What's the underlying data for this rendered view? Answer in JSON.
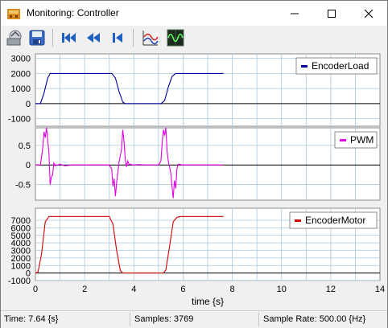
{
  "window": {
    "title": "Monitoring: Controller"
  },
  "toolbar": {
    "buttons": [
      {
        "name": "open-button",
        "icon": "open-folder-icon"
      },
      {
        "name": "save-button",
        "icon": "save-icon"
      },
      {
        "name": "go-to-start-button",
        "icon": "skip-to-start-icon"
      },
      {
        "name": "rewind-button",
        "icon": "rewind-icon"
      },
      {
        "name": "step-back-button",
        "icon": "step-back-icon"
      },
      {
        "name": "plot-settings-button",
        "icon": "plot-settings-icon"
      },
      {
        "name": "oscilloscope-button",
        "icon": "oscilloscope-icon"
      }
    ]
  },
  "colors": {
    "encoder_load": "#0000a0",
    "pwm": "#e000e0",
    "encoder_motor": "#d00000",
    "grid": "#aac8de",
    "zero_line": "#000000"
  },
  "chart_data": [
    {
      "type": "line",
      "legend_position": "top-right",
      "grid": true,
      "xlim": [
        0,
        14
      ],
      "ylim": [
        -1500,
        3300
      ],
      "y_ticks": [
        "3000",
        "2000",
        "1000",
        "0",
        "-1000"
      ],
      "series": [
        {
          "name": "EncoderLoad",
          "x": [
            0,
            0.2,
            0.35,
            0.5,
            0.6,
            3.1,
            3.25,
            3.4,
            3.55,
            3.65,
            5.1,
            5.25,
            5.4,
            5.55,
            5.7,
            7.64
          ],
          "y": [
            0,
            0,
            700,
            1700,
            2000,
            2000,
            1700,
            800,
            100,
            0,
            0,
            200,
            1100,
            1800,
            2000,
            2000
          ]
        }
      ]
    },
    {
      "type": "line",
      "legend_position": "top-right",
      "grid": true,
      "xlim": [
        0,
        14
      ],
      "ylim": [
        -0.9,
        0.95
      ],
      "y_ticks": [
        "0.5",
        "0",
        "-0.5"
      ],
      "series": [
        {
          "name": "PWM",
          "x": [
            0,
            0.2,
            0.25,
            0.3,
            0.35,
            0.4,
            0.45,
            0.55,
            0.6,
            0.65,
            0.7,
            0.75,
            0.8,
            1.0,
            1.2,
            1.5,
            2.0,
            2.5,
            3.0,
            3.1,
            3.15,
            3.2,
            3.25,
            3.3,
            3.4,
            3.5,
            3.55,
            3.6,
            3.65,
            3.7,
            3.75,
            3.8,
            4.0,
            4.2,
            4.5,
            5.0,
            5.1,
            5.15,
            5.2,
            5.25,
            5.3,
            5.35,
            5.4,
            5.5,
            5.55,
            5.6,
            5.65,
            5.7,
            5.75,
            5.8,
            6.0,
            6.5,
            7.0,
            7.64
          ],
          "y": [
            0,
            0,
            0.2,
            0.45,
            0.85,
            0.7,
            0.95,
            0.3,
            -0.5,
            -0.3,
            -0.25,
            0.05,
            -0.02,
            0.02,
            -0.02,
            0,
            0,
            0,
            0,
            -0.1,
            -0.55,
            -0.35,
            -0.8,
            -0.45,
            0.08,
            0.4,
            0.9,
            0.6,
            0.15,
            -0.05,
            0.1,
            0.02,
            0,
            0.01,
            0,
            0,
            0.1,
            0.55,
            0.9,
            0.75,
            0.95,
            0.35,
            0.1,
            -0.2,
            -0.55,
            -0.85,
            -0.4,
            -0.6,
            -0.1,
            0.02,
            0,
            0,
            0,
            0
          ]
        }
      ]
    },
    {
      "type": "line",
      "legend_position": "top-right",
      "grid": true,
      "xlim": [
        0,
        14
      ],
      "ylim": [
        -1000,
        8600
      ],
      "y_ticks": [
        "7000",
        "6000",
        "5000",
        "4000",
        "3000",
        "2000",
        "1000",
        "0",
        "-1000"
      ],
      "x_ticks": [
        "0",
        "2",
        "4",
        "6",
        "8",
        "10",
        "12",
        "14"
      ],
      "xlabel": "time {s}",
      "series": [
        {
          "name": "EncoderMotor",
          "x": [
            0,
            0.1,
            0.25,
            0.4,
            0.55,
            0.7,
            3.0,
            3.15,
            3.3,
            3.45,
            3.55,
            5.2,
            5.3,
            5.45,
            5.6,
            5.75,
            5.9,
            7.64
          ],
          "y": [
            0,
            100,
            2500,
            6800,
            7500,
            7500,
            7500,
            6500,
            3000,
            300,
            0,
            0,
            400,
            3500,
            6800,
            7400,
            7500,
            7500
          ]
        }
      ]
    }
  ],
  "status": {
    "time": "Time: 7.64 {s}",
    "samples": "Samples: 3769",
    "sample_rate": "Sample Rate: 500.00 {Hz}"
  }
}
